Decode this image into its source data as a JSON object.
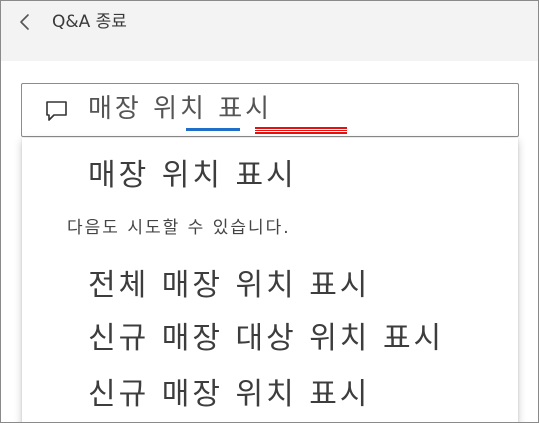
{
  "header": {
    "title": "Q&A 종료"
  },
  "search": {
    "query": "매장 위치 표시"
  },
  "dropdown": {
    "primary_suggestion": "매장 위치 표시",
    "also_try_label": "다음도 시도할 수 있습니다.",
    "alternatives": [
      "전체 매장 위치 표시",
      "신규 매장 대상 위치 표시",
      "신규 매장 위치 표시"
    ]
  },
  "colors": {
    "background": "#f3f3f3",
    "underline_blue": "#1f6fc8",
    "underline_red": "#e01212"
  }
}
